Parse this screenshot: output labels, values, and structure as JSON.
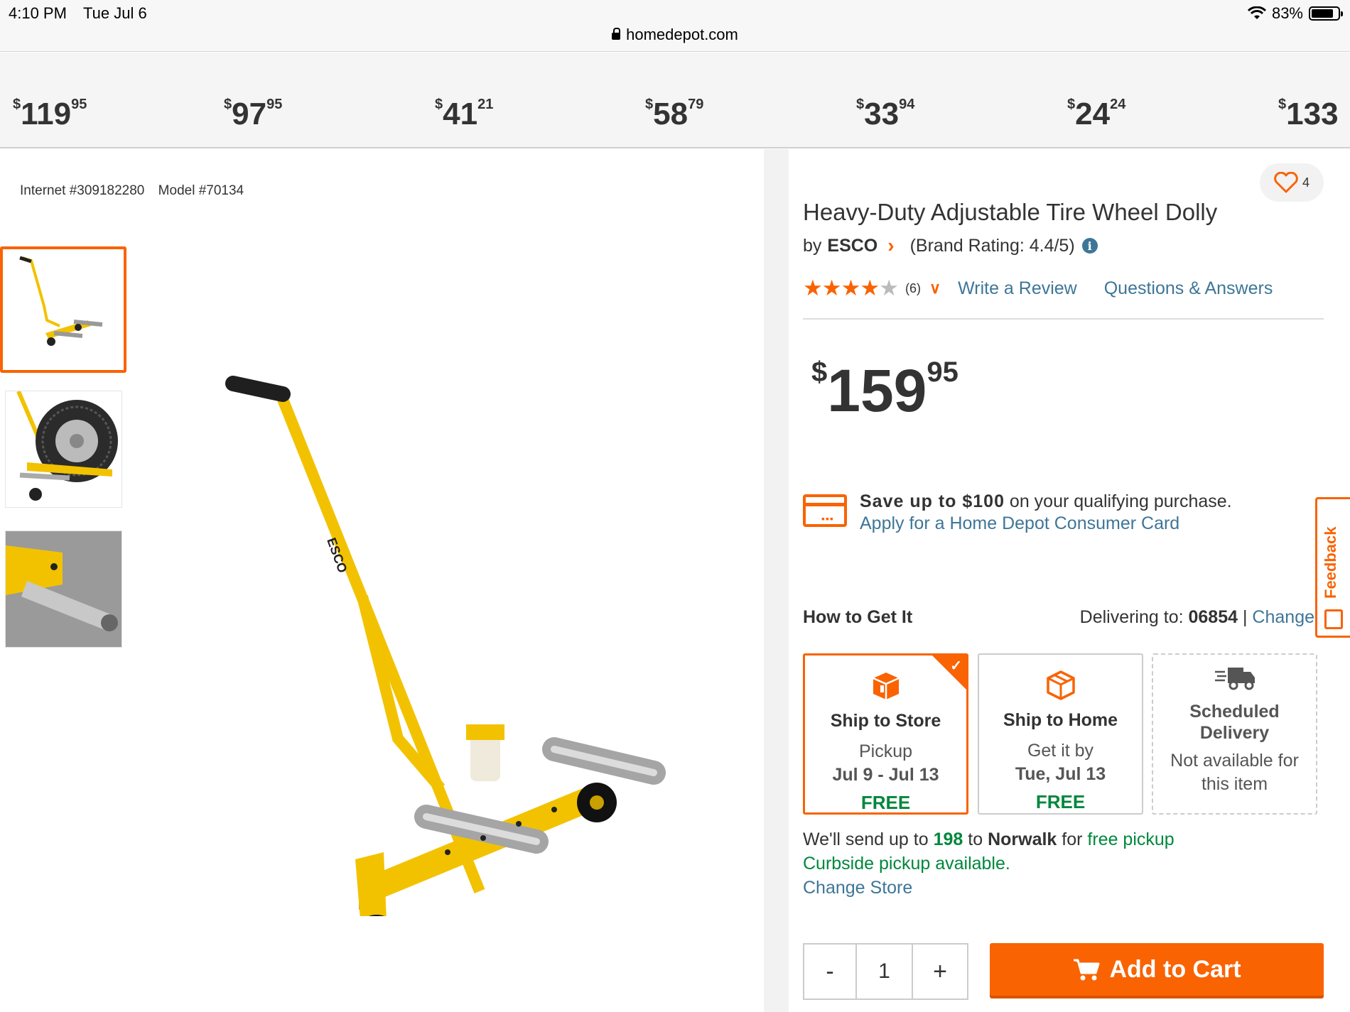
{
  "status_bar": {
    "time": "4:10 PM",
    "date": "Tue Jul 6",
    "battery": "83%",
    "battery_level": 0.83
  },
  "url": "homedepot.com",
  "price_strip": [
    {
      "dollars": "119",
      "cents": "95"
    },
    {
      "dollars": "97",
      "cents": "95"
    },
    {
      "dollars": "41",
      "cents": "21"
    },
    {
      "dollars": "58",
      "cents": "79"
    },
    {
      "dollars": "33",
      "cents": "94"
    },
    {
      "dollars": "24",
      "cents": "24"
    },
    {
      "dollars": "133",
      "cents": ""
    }
  ],
  "currency_symbol": "$",
  "product": {
    "internet_no": "Internet #309182280",
    "model_no": "Model #70134",
    "favorite_count": "4",
    "title": "Heavy-Duty Adjustable Tire Wheel Dolly",
    "by": "by",
    "brand": "ESCO",
    "brand_rating": "(Brand Rating: 4.4/5)",
    "stars_filled": 4,
    "stars_total": 5,
    "review_count": "(6)",
    "write_review": "Write a Review",
    "qa": "Questions & Answers",
    "price_dollars": "159",
    "price_cents": "95"
  },
  "promo": {
    "save_bold": "Save up to $100",
    "save_rest": " on your qualifying purchase.",
    "apply_link": "Apply for a Home Depot Consumer Card"
  },
  "how_to_get": {
    "title": "How to Get It",
    "delivering_label": "Delivering to: ",
    "zip": "06854",
    "separator": " | ",
    "change": "Change"
  },
  "fulfillment": [
    {
      "name": "Ship to Store",
      "sub": "Pickup",
      "date": "Jul 9 - Jul 13",
      "price": "FREE",
      "selected": true
    },
    {
      "name": "Ship to Home",
      "sub": "Get it by",
      "date": "Tue, Jul 13",
      "price": "FREE",
      "selected": false
    },
    {
      "name": "Scheduled Delivery",
      "sub": "Not available for this item",
      "date": "",
      "price": "",
      "selected": false
    }
  ],
  "pickup": {
    "send_pre": "We'll send up to ",
    "count": "198",
    "to": " to ",
    "store": "Norwalk",
    "for": " for ",
    "free_pickup": "free pickup",
    "curbside": "Curbside pickup available.",
    "change_store": "Change Store"
  },
  "cart": {
    "minus": "-",
    "qty": "1",
    "plus": "+",
    "add_label": "Add to Cart"
  },
  "feedback_label": "Feedback",
  "colors": {
    "brand_orange": "#f96302",
    "link_blue": "#3e7697",
    "green": "#00873c",
    "dolly_yellow": "#f2c200"
  }
}
